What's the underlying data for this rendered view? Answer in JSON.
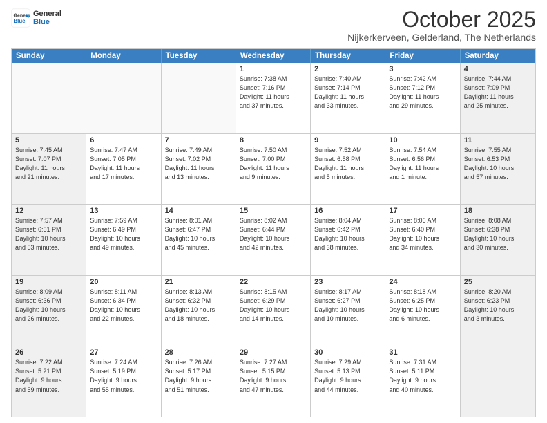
{
  "header": {
    "logo_line1": "General",
    "logo_line2": "Blue",
    "month": "October 2025",
    "location": "Nijkerkerveen, Gelderland, The Netherlands"
  },
  "days_of_week": [
    "Sunday",
    "Monday",
    "Tuesday",
    "Wednesday",
    "Thursday",
    "Friday",
    "Saturday"
  ],
  "rows": [
    [
      {
        "day": "",
        "info": "",
        "empty": true
      },
      {
        "day": "",
        "info": "",
        "empty": true
      },
      {
        "day": "",
        "info": "",
        "empty": true
      },
      {
        "day": "1",
        "info": "Sunrise: 7:38 AM\nSunset: 7:16 PM\nDaylight: 11 hours\nand 37 minutes."
      },
      {
        "day": "2",
        "info": "Sunrise: 7:40 AM\nSunset: 7:14 PM\nDaylight: 11 hours\nand 33 minutes."
      },
      {
        "day": "3",
        "info": "Sunrise: 7:42 AM\nSunset: 7:12 PM\nDaylight: 11 hours\nand 29 minutes."
      },
      {
        "day": "4",
        "info": "Sunrise: 7:44 AM\nSunset: 7:09 PM\nDaylight: 11 hours\nand 25 minutes.",
        "shaded": true
      }
    ],
    [
      {
        "day": "5",
        "info": "Sunrise: 7:45 AM\nSunset: 7:07 PM\nDaylight: 11 hours\nand 21 minutes.",
        "shaded": true
      },
      {
        "day": "6",
        "info": "Sunrise: 7:47 AM\nSunset: 7:05 PM\nDaylight: 11 hours\nand 17 minutes."
      },
      {
        "day": "7",
        "info": "Sunrise: 7:49 AM\nSunset: 7:02 PM\nDaylight: 11 hours\nand 13 minutes."
      },
      {
        "day": "8",
        "info": "Sunrise: 7:50 AM\nSunset: 7:00 PM\nDaylight: 11 hours\nand 9 minutes."
      },
      {
        "day": "9",
        "info": "Sunrise: 7:52 AM\nSunset: 6:58 PM\nDaylight: 11 hours\nand 5 minutes."
      },
      {
        "day": "10",
        "info": "Sunrise: 7:54 AM\nSunset: 6:56 PM\nDaylight: 11 hours\nand 1 minute."
      },
      {
        "day": "11",
        "info": "Sunrise: 7:55 AM\nSunset: 6:53 PM\nDaylight: 10 hours\nand 57 minutes.",
        "shaded": true
      }
    ],
    [
      {
        "day": "12",
        "info": "Sunrise: 7:57 AM\nSunset: 6:51 PM\nDaylight: 10 hours\nand 53 minutes.",
        "shaded": true
      },
      {
        "day": "13",
        "info": "Sunrise: 7:59 AM\nSunset: 6:49 PM\nDaylight: 10 hours\nand 49 minutes."
      },
      {
        "day": "14",
        "info": "Sunrise: 8:01 AM\nSunset: 6:47 PM\nDaylight: 10 hours\nand 45 minutes."
      },
      {
        "day": "15",
        "info": "Sunrise: 8:02 AM\nSunset: 6:44 PM\nDaylight: 10 hours\nand 42 minutes."
      },
      {
        "day": "16",
        "info": "Sunrise: 8:04 AM\nSunset: 6:42 PM\nDaylight: 10 hours\nand 38 minutes."
      },
      {
        "day": "17",
        "info": "Sunrise: 8:06 AM\nSunset: 6:40 PM\nDaylight: 10 hours\nand 34 minutes."
      },
      {
        "day": "18",
        "info": "Sunrise: 8:08 AM\nSunset: 6:38 PM\nDaylight: 10 hours\nand 30 minutes.",
        "shaded": true
      }
    ],
    [
      {
        "day": "19",
        "info": "Sunrise: 8:09 AM\nSunset: 6:36 PM\nDaylight: 10 hours\nand 26 minutes.",
        "shaded": true
      },
      {
        "day": "20",
        "info": "Sunrise: 8:11 AM\nSunset: 6:34 PM\nDaylight: 10 hours\nand 22 minutes."
      },
      {
        "day": "21",
        "info": "Sunrise: 8:13 AM\nSunset: 6:32 PM\nDaylight: 10 hours\nand 18 minutes."
      },
      {
        "day": "22",
        "info": "Sunrise: 8:15 AM\nSunset: 6:29 PM\nDaylight: 10 hours\nand 14 minutes."
      },
      {
        "day": "23",
        "info": "Sunrise: 8:17 AM\nSunset: 6:27 PM\nDaylight: 10 hours\nand 10 minutes."
      },
      {
        "day": "24",
        "info": "Sunrise: 8:18 AM\nSunset: 6:25 PM\nDaylight: 10 hours\nand 6 minutes."
      },
      {
        "day": "25",
        "info": "Sunrise: 8:20 AM\nSunset: 6:23 PM\nDaylight: 10 hours\nand 3 minutes.",
        "shaded": true
      }
    ],
    [
      {
        "day": "26",
        "info": "Sunrise: 7:22 AM\nSunset: 5:21 PM\nDaylight: 9 hours\nand 59 minutes.",
        "shaded": true
      },
      {
        "day": "27",
        "info": "Sunrise: 7:24 AM\nSunset: 5:19 PM\nDaylight: 9 hours\nand 55 minutes."
      },
      {
        "day": "28",
        "info": "Sunrise: 7:26 AM\nSunset: 5:17 PM\nDaylight: 9 hours\nand 51 minutes."
      },
      {
        "day": "29",
        "info": "Sunrise: 7:27 AM\nSunset: 5:15 PM\nDaylight: 9 hours\nand 47 minutes."
      },
      {
        "day": "30",
        "info": "Sunrise: 7:29 AM\nSunset: 5:13 PM\nDaylight: 9 hours\nand 44 minutes."
      },
      {
        "day": "31",
        "info": "Sunrise: 7:31 AM\nSunset: 5:11 PM\nDaylight: 9 hours\nand 40 minutes."
      },
      {
        "day": "",
        "info": "",
        "empty": true,
        "shaded": true
      }
    ]
  ]
}
